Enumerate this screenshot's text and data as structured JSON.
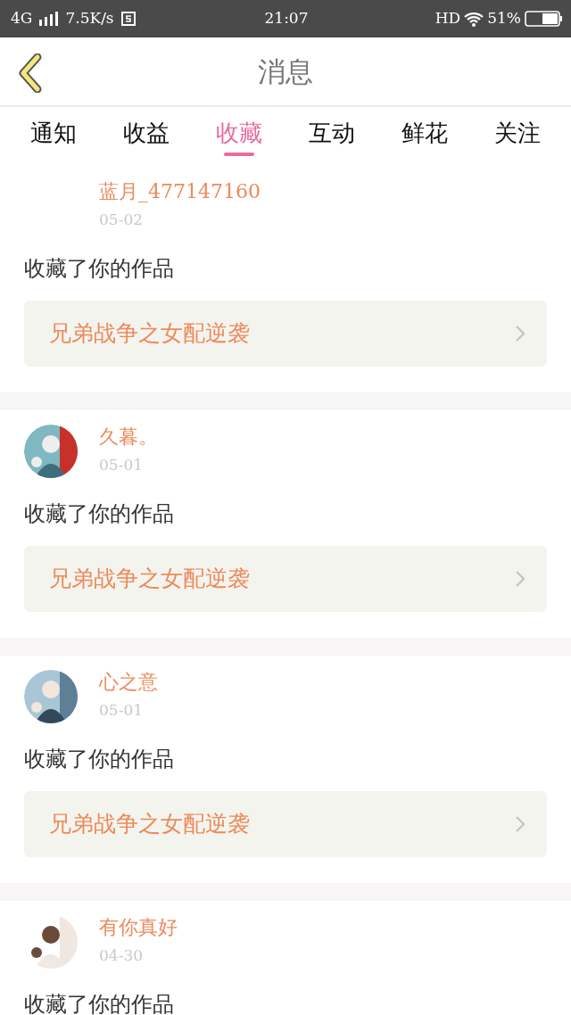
{
  "status_bar": {
    "network": "4G",
    "speed": "7.5K/s",
    "time": "21:07",
    "hd": "HD",
    "battery_text": "51%"
  },
  "header": {
    "title": "消息"
  },
  "tabs": [
    {
      "label": "通知",
      "selected": false
    },
    {
      "label": "收益",
      "selected": false
    },
    {
      "label": "收藏",
      "selected": true
    },
    {
      "label": "互动",
      "selected": false
    },
    {
      "label": "鲜花",
      "selected": false
    },
    {
      "label": "关注",
      "selected": false
    }
  ],
  "messages": [
    {
      "user": "蓝月_477147160",
      "date": "05-02",
      "action": "收藏了你的作品",
      "work": "兄弟战争之女配逆袭"
    },
    {
      "user": "久暮。",
      "date": "05-01",
      "action": "收藏了你的作品",
      "work": "兄弟战争之女配逆袭"
    },
    {
      "user": "心之意",
      "date": "05-01",
      "action": "收藏了你的作品",
      "work": "兄弟战争之女配逆袭"
    },
    {
      "user": "有你真好",
      "date": "04-30",
      "action": "收藏了你的作品"
    }
  ]
}
